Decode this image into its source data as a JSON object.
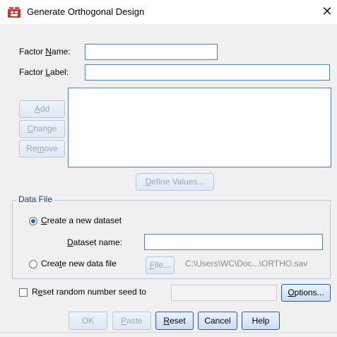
{
  "window": {
    "title": "Generate Orthogonal Design",
    "close_glyph": "✕",
    "icon": "spss-dialog-icon"
  },
  "fields": {
    "factor_name": {
      "prefix": "Factor ",
      "access": "N",
      "suffix": "ame:",
      "value": ""
    },
    "factor_label": {
      "prefix": "Factor ",
      "access": "L",
      "suffix": "abel:",
      "value": ""
    }
  },
  "factor_buttons": {
    "add": {
      "prefix": "",
      "access": "A",
      "suffix": "dd"
    },
    "change": {
      "prefix": "",
      "access": "C",
      "suffix": "hange"
    },
    "remove": {
      "prefix": "Re",
      "access": "m",
      "suffix": "ove"
    }
  },
  "define_values": {
    "prefix": "",
    "access": "D",
    "suffix": "efine Values..."
  },
  "data_file": {
    "legend": "Data File",
    "create_dataset": {
      "prefix": "",
      "access": "C",
      "suffix": "reate a new dataset",
      "selected": true
    },
    "dataset_name": {
      "prefix": "",
      "access": "D",
      "suffix": "ataset name:",
      "value": ""
    },
    "create_file": {
      "prefix": "Crea",
      "access": "t",
      "suffix": "e new data file",
      "selected": false
    },
    "file_button": {
      "prefix": "",
      "access": "F",
      "suffix": "ile..."
    },
    "file_path": "C:\\Users\\WC\\Doc...\\ORTHO.sav"
  },
  "seed": {
    "prefix": "R",
    "access": "e",
    "suffix": "set random number seed to",
    "checked": false,
    "value": ""
  },
  "options_button": {
    "prefix": "",
    "access": "O",
    "suffix": "ptions..."
  },
  "actions": {
    "ok": "OK",
    "paste": {
      "prefix": "",
      "access": "P",
      "suffix": "aste"
    },
    "reset": {
      "prefix": "",
      "access": "R",
      "suffix": "eset"
    },
    "cancel": "Cancel",
    "help": "Help"
  },
  "colors": {
    "dialog_bg": "#f0f0f0",
    "input_border": "#5b7ea8",
    "disabled_text": "#9aa7b8",
    "group_legend": "#1c3d7a"
  }
}
